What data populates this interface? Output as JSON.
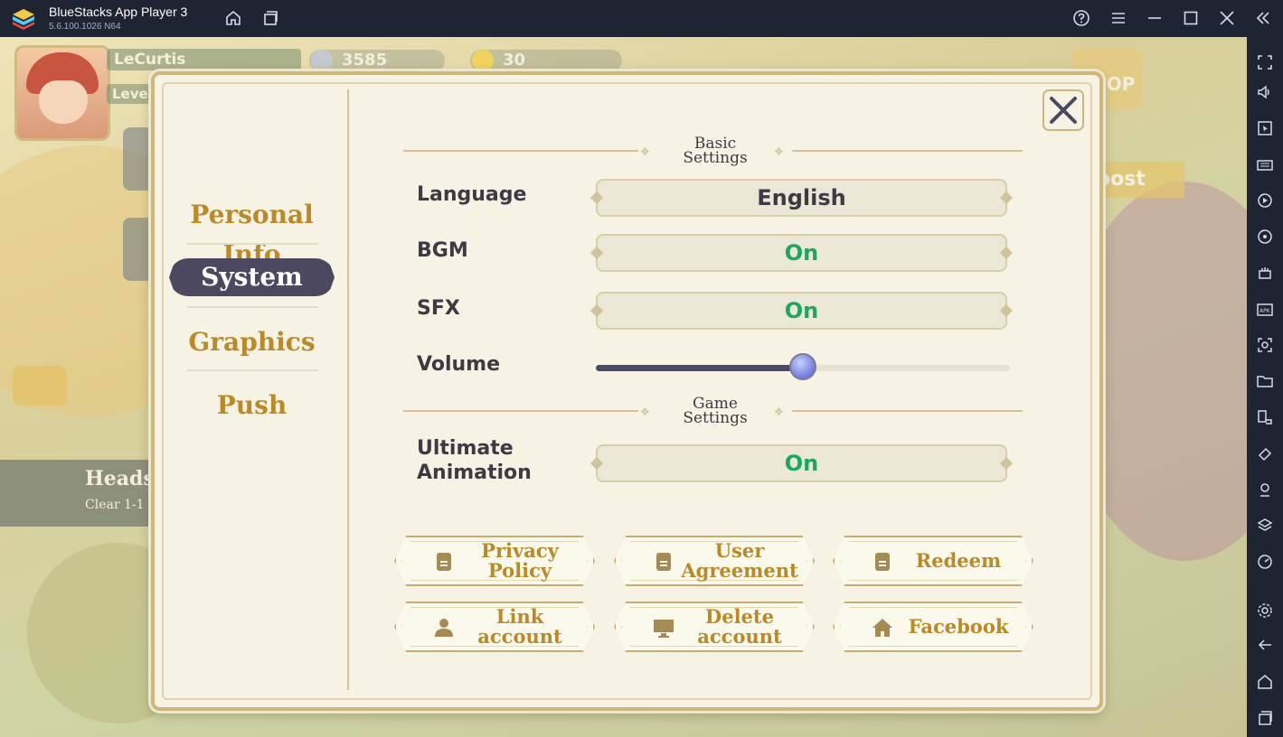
{
  "window": {
    "title": "BlueStacks App Player 3",
    "version": "5.6.100.1026  N64"
  },
  "hud": {
    "player_name": "LeCurtis",
    "level_label": "Leve",
    "gems": "3585",
    "coins": "30",
    "shop_label": "SHOP",
    "boost_label": "oost",
    "banner_title": "Heads",
    "banner_sub": "Clear 1-1"
  },
  "settings": {
    "nav": [
      {
        "label": "Personal Info"
      },
      {
        "label": "System"
      },
      {
        "label": "Graphics"
      },
      {
        "label": "Push"
      }
    ],
    "basic_header": [
      "Basic",
      "Settings"
    ],
    "game_header": [
      "Game",
      "Settings"
    ],
    "language": {
      "label": "Language",
      "value": "English"
    },
    "bgm": {
      "label": "BGM",
      "value": "On"
    },
    "sfx": {
      "label": "SFX",
      "value": "On"
    },
    "volume": {
      "label": "Volume",
      "level": 0.5
    },
    "ultimate": {
      "label_line1": "Ultimate",
      "label_line2": "Animation",
      "value": "On"
    },
    "buttons": [
      {
        "label_line1": "Privacy",
        "label_line2": "Policy",
        "icon": "document-icon"
      },
      {
        "label_line1": "User",
        "label_line2": "Agreement",
        "icon": "document-icon"
      },
      {
        "label_line1": "Redeem",
        "label_line2": "",
        "icon": "document-icon"
      },
      {
        "label_line1": "Link",
        "label_line2": "account",
        "icon": "user-icon"
      },
      {
        "label_line1": "Delete",
        "label_line2": "account",
        "icon": "monitor-icon"
      },
      {
        "label_line1": "Facebook",
        "label_line2": "",
        "icon": "home-icon"
      }
    ]
  },
  "colors": {
    "accent_gold": "#b9892a",
    "on_green": "#1ea661",
    "nav_active": "#4c4860"
  }
}
